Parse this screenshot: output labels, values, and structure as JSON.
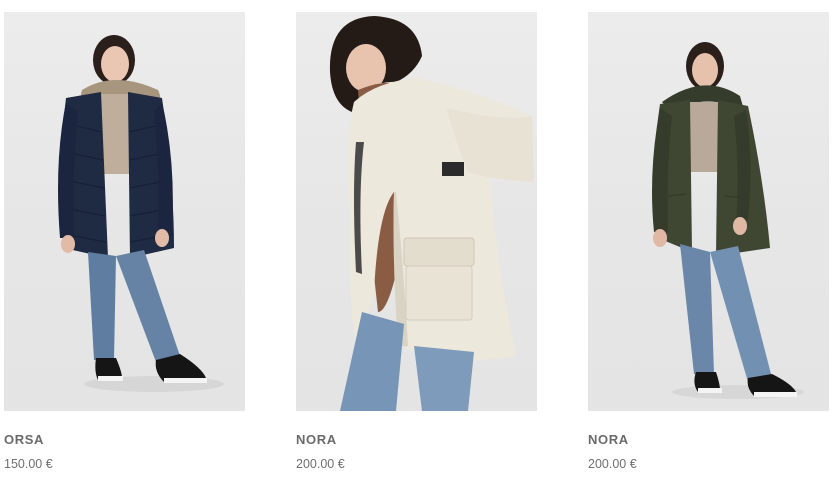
{
  "products": [
    {
      "name": "ORSA",
      "price": "150.00 €",
      "coat_color": "#1f2a43",
      "sweater_color": "#bfae9c"
    },
    {
      "name": "NORA",
      "price": "200.00 €",
      "coat_color": "#ece8dc",
      "sweater_color": "#8a5c44"
    },
    {
      "name": "NORA",
      "price": "200.00 €",
      "coat_color": "#3f4632",
      "sweater_color": "#b9a99a"
    }
  ]
}
